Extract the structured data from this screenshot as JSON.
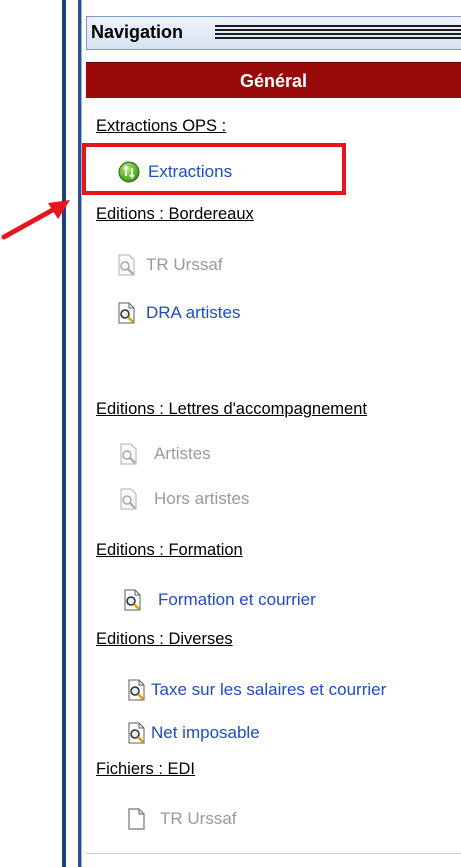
{
  "panel": {
    "title": "Navigation",
    "section": "Général"
  },
  "groups": [
    {
      "label": "Extractions OPS :",
      "items": [
        {
          "label": "Extractions",
          "icon": "green-circle-arrows-icon",
          "enabled": true
        }
      ]
    },
    {
      "label": "Editions : Bordereaux",
      "items": [
        {
          "label": "TR Urssaf",
          "icon": "document-magnifier-icon",
          "enabled": false
        },
        {
          "label": "DRA artistes",
          "icon": "document-magnifier-icon",
          "enabled": true
        }
      ]
    },
    {
      "label": "Editions : Lettres d'accompagnement",
      "items": [
        {
          "label": "Artistes",
          "icon": "document-magnifier-icon",
          "enabled": false
        },
        {
          "label": "Hors artistes",
          "icon": "document-magnifier-icon",
          "enabled": false
        }
      ]
    },
    {
      "label": "Editions : Formation",
      "items": [
        {
          "label": "Formation et courrier",
          "icon": "document-magnifier-icon",
          "enabled": true
        }
      ]
    },
    {
      "label": "Editions : Diverses",
      "items": [
        {
          "label": "Taxe sur les salaires et courrier",
          "icon": "document-magnifier-icon",
          "enabled": true
        },
        {
          "label": "Net imposable",
          "icon": "document-magnifier-icon",
          "enabled": true
        }
      ]
    },
    {
      "label": "Fichiers : EDI",
      "items": [
        {
          "label": "TR Urssaf",
          "icon": "document-icon",
          "enabled": false
        }
      ]
    }
  ],
  "colors": {
    "section_header_bg": "#9b0a0a",
    "link_enabled": "#1c4cc8",
    "link_disabled": "#9a9a9a",
    "annotation": "#e8141b"
  }
}
